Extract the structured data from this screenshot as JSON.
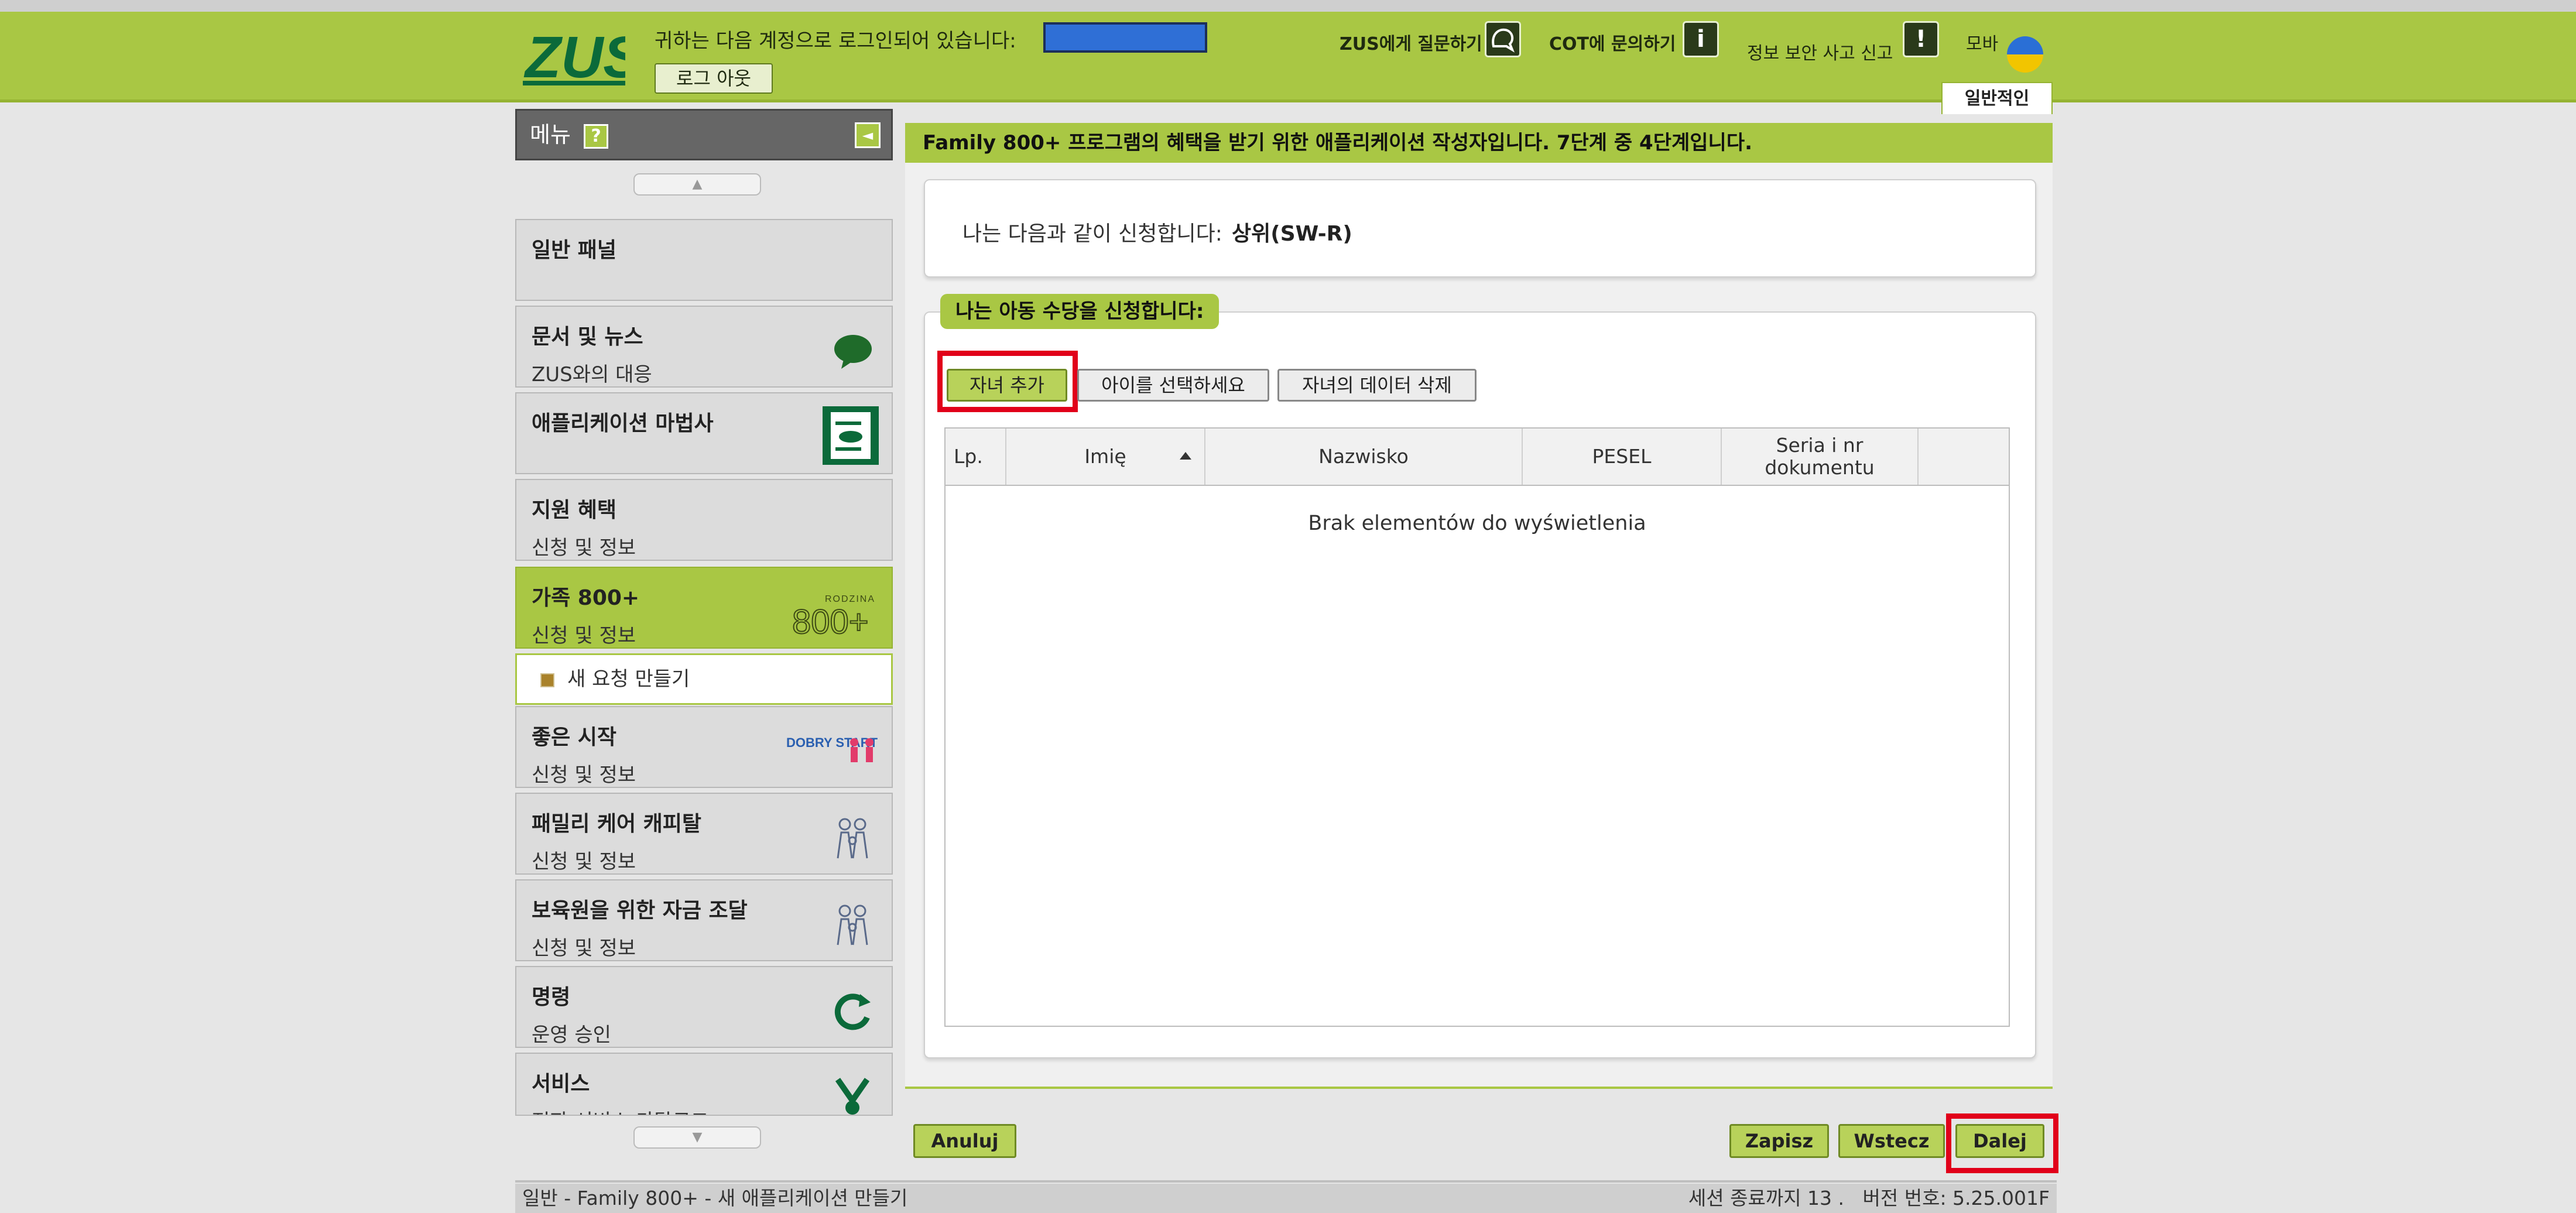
{
  "header": {
    "logo_text": "ZUS",
    "logged_in_text": "귀하는 다음 계정으로 로그인되어 있습니다:",
    "logout_label": "로그 아웃",
    "ask_zus_label": "ZUS에게 질문하기",
    "contact_cot_label": "COT에 문의하기",
    "report_security_label": "정보 보안 사고 신고",
    "mobile_label": "모바",
    "general_tab_label": "일반적인"
  },
  "sidebar": {
    "title": "메뉴",
    "help_label": "?",
    "items": [
      {
        "title": "일반 패널",
        "subtitle": ""
      },
      {
        "title": "문서 및 뉴스",
        "subtitle": "ZUS와의 대응"
      },
      {
        "title": "애플리케이션 마법사",
        "subtitle": ""
      },
      {
        "title": "지원 혜택",
        "subtitle": "신청 및 정보"
      },
      {
        "title": "가족 800+",
        "subtitle": "신청 및 정보"
      },
      {
        "title": "좋은 시작",
        "subtitle": "신청 및 정보"
      },
      {
        "title": "패밀리 케어 캐피탈",
        "subtitle": "신청 및 정보"
      },
      {
        "title": "보육원을 위한 자금 조달",
        "subtitle": "신청 및 정보"
      },
      {
        "title": "명령",
        "subtitle": "운영 승인"
      },
      {
        "title": "서비스",
        "subtitle": "전자 서비스 카탈로그"
      }
    ],
    "sub_item_label": "새 요청 만들기",
    "family_badge_top": "RODZINA",
    "family_badge_num": "800+",
    "dobry_start_text": "DOBRY START"
  },
  "main": {
    "heading": "Family 800+ 프로그램의 혜택을 받기 위한 애플리케이션 작성자입니다. 7단계 중 4단계입니다.",
    "apply_as_label": "나는 다음과 같이 신청합니다:",
    "apply_as_value": "상위(SW-R)",
    "section_title": "나는 아동 수당을 신청합니다:",
    "toolbar": {
      "add_child": "자녀 추가",
      "select_child": "아이를 선택하세요",
      "delete_child": "자녀의 데이터 삭제"
    },
    "table": {
      "columns": [
        "Lp.",
        "Imię",
        "Nazwisko",
        "PESEL",
        "Seria i nr dokumentu",
        ""
      ],
      "empty_message": "Brak elementów do wyświetlenia"
    }
  },
  "footer": {
    "cancel": "Anuluj",
    "save": "Zapisz",
    "back": "Wstecz",
    "next": "Dalej"
  },
  "status_bar": {
    "breadcrumb": "일반 - Family 800+ - 새 애플리케이션 만들기",
    "session_text": "세션 종료까지 13 .",
    "version_text": "버전 번호: 5.25.001F"
  },
  "colors": {
    "brand_green": "#a9c744",
    "highlight_red": "#e1001a",
    "logo_green": "#0b6a3a"
  }
}
